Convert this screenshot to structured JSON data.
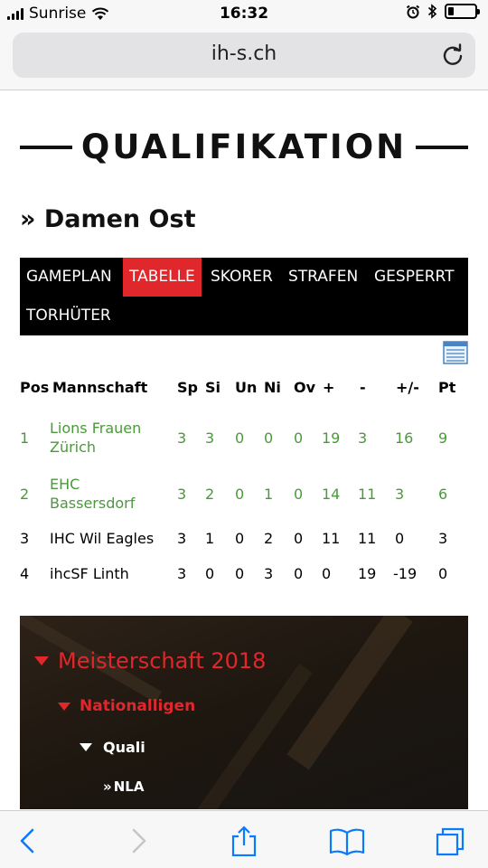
{
  "status": {
    "carrier": "Sunrise",
    "time": "16:32",
    "battery_level": 0.2
  },
  "browser": {
    "url": "ih-s.ch"
  },
  "page": {
    "title": "QUALIFIKATION",
    "subtitle": "» Damen Ost"
  },
  "tabs": [
    {
      "label": "GAMEPLAN",
      "active": false
    },
    {
      "label": "TABELLE",
      "active": true
    },
    {
      "label": "SKORER",
      "active": false
    },
    {
      "label": "STRAFEN",
      "active": false
    },
    {
      "label": "GESPERRT",
      "active": false
    },
    {
      "label": "TORHÜTER",
      "active": false
    }
  ],
  "standings": {
    "headers": [
      "Pos",
      "Mannschaft",
      "Sp",
      "Si",
      "Un",
      "Ni",
      "Ov",
      "+",
      "-",
      "+/-",
      "Pt"
    ],
    "rows": [
      {
        "pos": "1",
        "team_line1": "Lions Frauen",
        "team_line2": "Zürich",
        "sp": "3",
        "si": "3",
        "un": "0",
        "ni": "0",
        "ov": "0",
        "plus": "19",
        "minus": "3",
        "diff": "16",
        "pt": "9",
        "highlight": true
      },
      {
        "pos": "2",
        "team_line1": "EHC",
        "team_line2": "Bassersdorf",
        "sp": "3",
        "si": "2",
        "un": "0",
        "ni": "1",
        "ov": "0",
        "plus": "14",
        "minus": "11",
        "diff": "3",
        "pt": "6",
        "highlight": true
      },
      {
        "pos": "3",
        "team_line1": "IHC Wil Eagles",
        "team_line2": "",
        "sp": "3",
        "si": "1",
        "un": "0",
        "ni": "2",
        "ov": "0",
        "plus": "11",
        "minus": "11",
        "diff": "0",
        "pt": "3",
        "highlight": false
      },
      {
        "pos": "4",
        "team_line1": "ihcSF Linth",
        "team_line2": "",
        "sp": "3",
        "si": "0",
        "un": "0",
        "ni": "3",
        "ov": "0",
        "plus": "0",
        "minus": "19",
        "diff": "-19",
        "pt": "0",
        "highlight": false
      }
    ]
  },
  "menu": {
    "level1": "Meisterschaft 2018",
    "level2": "Nationalligen",
    "level3": "Quali",
    "level4": "NLA",
    "level4_prefix": "»"
  },
  "colors": {
    "accent": "#e0272c",
    "highlight_text": "#4a9a3a",
    "ios_blue": "#0a7aff"
  }
}
